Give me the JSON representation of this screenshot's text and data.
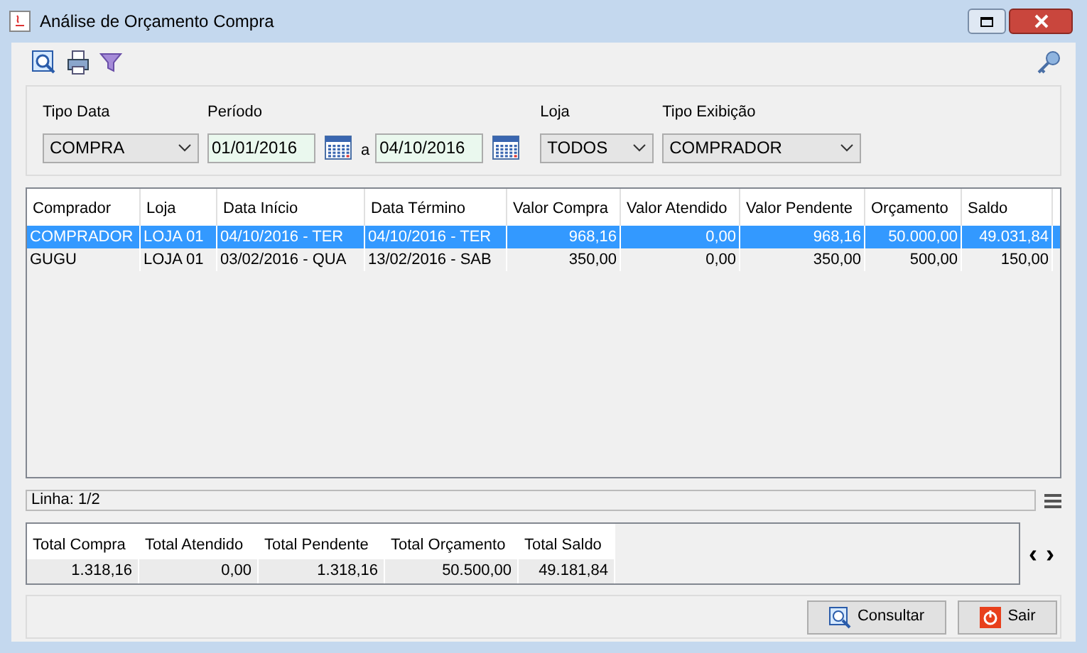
{
  "window": {
    "title": "Análise de Orçamento Compra"
  },
  "filters": [
    {
      "kind": "select",
      "label": "Tipo Data",
      "value": "COMPRA"
    },
    {
      "kind": "daterange",
      "label": "Período",
      "from": "01/01/2016",
      "separator": "a",
      "to": "04/10/2016"
    },
    {
      "kind": "select",
      "label": "Loja",
      "value": "TODOS"
    },
    {
      "kind": "select",
      "label": "Tipo Exibição",
      "value": "COMPRADOR"
    }
  ],
  "table": {
    "columns": [
      "Comprador",
      "Loja",
      "Data Início",
      "Data Término",
      "Valor Compra",
      "Valor Atendido",
      "Valor Pendente",
      "Orçamento",
      "Saldo"
    ],
    "rows": [
      {
        "selected": true,
        "cells": [
          "COMPRADOR",
          "LOJA 01",
          "04/10/2016 - TER",
          "04/10/2016 - TER",
          "968,16",
          "0,00",
          "968,16",
          "50.000,00",
          "49.031,84"
        ]
      },
      {
        "selected": false,
        "cells": [
          "GUGU",
          "LOJA 01",
          "03/02/2016 - QUA",
          "13/02/2016 - SAB",
          "350,00",
          "0,00",
          "350,00",
          "500,00",
          "150,00"
        ]
      }
    ]
  },
  "status_bar": {
    "text": "Linha: 1/2"
  },
  "totals": [
    {
      "label": "Total Compra",
      "value": "1.318,16"
    },
    {
      "label": "Total Atendido",
      "value": "0,00"
    },
    {
      "label": "Total Pendente",
      "value": "1.318,16"
    },
    {
      "label": "Total Orçamento",
      "value": "50.500,00"
    },
    {
      "label": "Total Saldo",
      "value": "49.181,84"
    }
  ],
  "totals_nav": {
    "prev": "‹",
    "next": "›"
  },
  "buttons": [
    {
      "kind": "search",
      "label": "Consultar"
    },
    {
      "kind": "exit",
      "label": "Sair"
    }
  ]
}
